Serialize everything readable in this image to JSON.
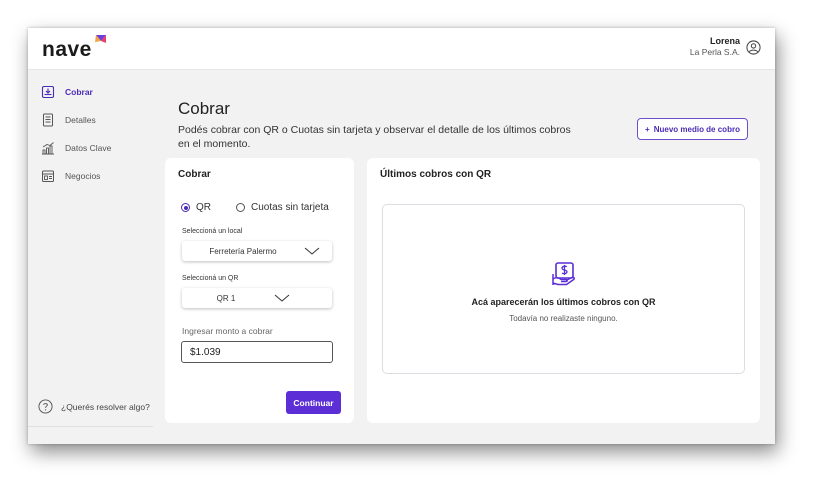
{
  "brand": {
    "logo_text": "nave",
    "accent": "#5b2ed6"
  },
  "user": {
    "name": "Lorena",
    "company": "La Perla S.A.",
    "icon": "user-circle-icon"
  },
  "sidebar": {
    "items": [
      {
        "label": "Cobrar",
        "icon": "cobrar-icon",
        "active": true
      },
      {
        "label": "Detalles",
        "icon": "document-icon",
        "active": false
      },
      {
        "label": "Datos Clave",
        "icon": "chart-icon",
        "active": false
      },
      {
        "label": "Negocios",
        "icon": "store-icon",
        "active": false
      }
    ],
    "help_label": "¿Querés resolver algo?"
  },
  "main": {
    "title": "Cobrar",
    "description": "Podés cobrar con QR o Cuotas sin tarjeta y observar el detalle de los últimos cobros en el momento.",
    "new_method_plus": "+",
    "new_method_label": "Nuevo medio de cobro"
  },
  "cobrar_card": {
    "title": "Cobrar",
    "options": [
      "QR",
      "Cuotas sin tarjeta"
    ],
    "selected_option": "QR",
    "local_label": "Seleccioná un local",
    "local_value": "Ferretería Palermo",
    "qr_label": "Seleccioná un QR",
    "qr_value": "QR 1",
    "amount_label": "Ingresar monto a cobrar",
    "amount_value": "$1.039",
    "continue_label": "Continuar"
  },
  "ultimos_card": {
    "title": "Últimos cobros con QR",
    "empty_icon": "money-hand-icon",
    "empty_title": "Acá aparecerán los últimos cobros con QR",
    "empty_subtitle": "Todavía no realizaste ninguno."
  }
}
